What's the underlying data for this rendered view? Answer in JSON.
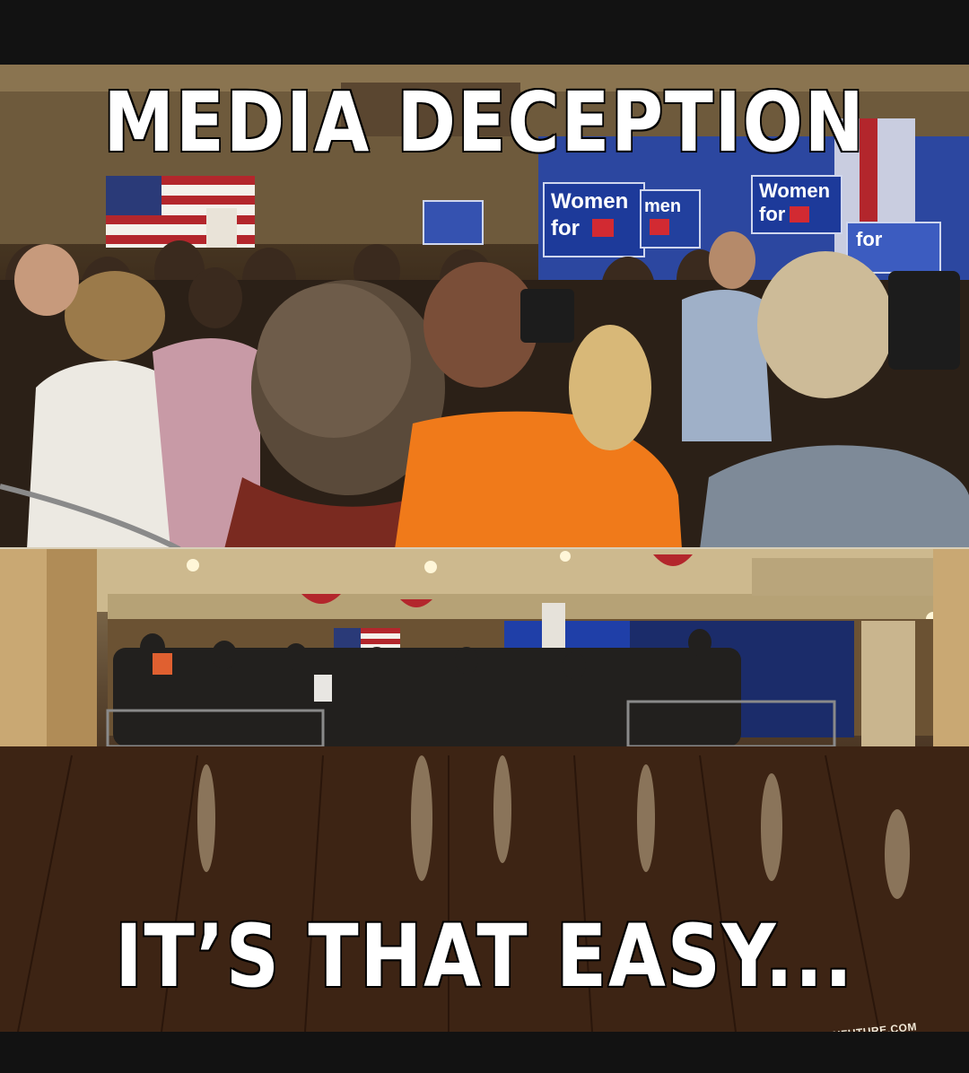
{
  "meme": {
    "top_caption": "MEDIA DECEPTION",
    "bottom_caption": "IT’S THAT EASY...",
    "watermark": "ALIBERTARIANFUTURE.COM",
    "signs": {
      "sign_1_line_1": "Women",
      "sign_1_line_2": "for",
      "sign_2_line_1": "men",
      "sign_3_line_1": "Women",
      "sign_3_line_2": "for",
      "sign_4_line_1": "for"
    }
  },
  "colors": {
    "background": "#121212",
    "caption_fill": "#ffffff",
    "caption_outline": "#000000",
    "sign_blue": "#1d3a9a",
    "shirt_orange": "#f07a1a"
  }
}
